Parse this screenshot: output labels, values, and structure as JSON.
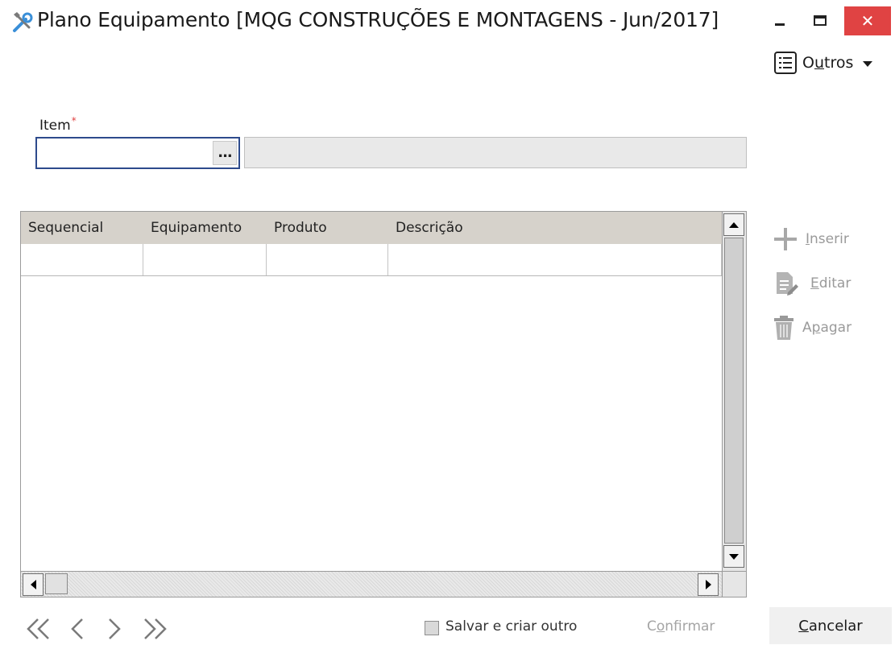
{
  "window": {
    "title": "Plano Equipamento [MQG CONSTRUÇÕES E MONTAGENS - Jun/2017]",
    "close_glyph": "✕"
  },
  "menu": {
    "outros_prefix": "O",
    "outros_hotkey": "u",
    "outros_suffix": "tros"
  },
  "form": {
    "item_label": "Item",
    "required_mark": "*",
    "item_value": "",
    "lookup_label": "...",
    "item_description": ""
  },
  "grid": {
    "columns": [
      "Sequencial",
      "Equipamento",
      "Produto",
      "Descrição"
    ],
    "rows": []
  },
  "actions": {
    "insert": {
      "hotkey": "I",
      "rest": "nserir"
    },
    "edit": {
      "hotkey": "E",
      "rest": "ditar"
    },
    "delete": {
      "prefix": "A",
      "hotkey": "p",
      "rest": "agar"
    }
  },
  "footer": {
    "save_and_new": "Salvar e criar outro",
    "save_and_new_checked": false,
    "confirm": {
      "prefix": "C",
      "hotkey": "o",
      "rest": "nfirmar"
    },
    "cancel": {
      "hotkey": "C",
      "rest": "ancelar"
    },
    "nav_first": "«",
    "nav_prev": "‹",
    "nav_next": "›",
    "nav_last": "»"
  },
  "icons": {
    "app": "tools-icon",
    "outros": "list-icon",
    "insert": "plus-icon",
    "edit": "edit-document-icon",
    "delete": "trash-icon"
  },
  "colors": {
    "close_button": "#e04343",
    "input_focus_border": "#2d4a8c",
    "grid_header": "#d6d2cb",
    "disabled_text": "#9a9a9a",
    "required": "#e04040"
  }
}
